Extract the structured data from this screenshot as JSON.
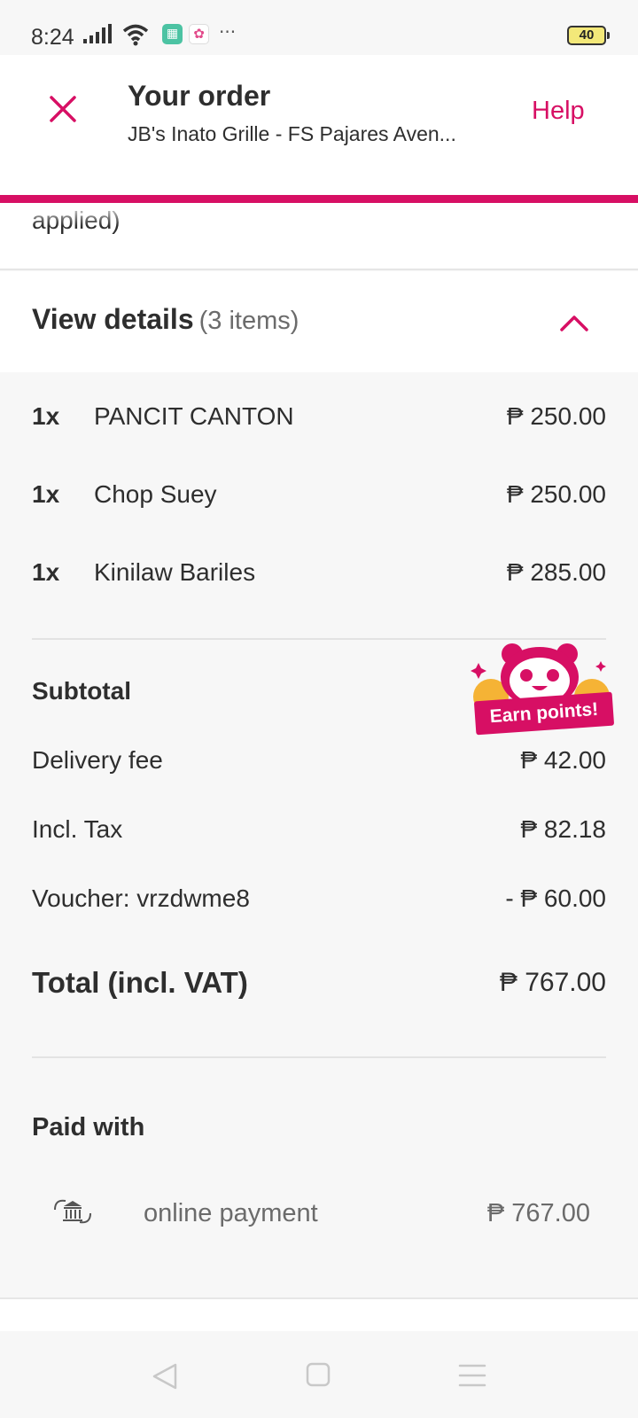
{
  "status_bar": {
    "time": "8:24",
    "battery": "40",
    "more": "···"
  },
  "header": {
    "title": "Your order",
    "subtitle": "JB's Inato Grille - FS Pajares Aven...",
    "help_label": "Help",
    "close_icon": "close-icon"
  },
  "applied_text": "applied)",
  "details": {
    "title": "View details",
    "count": "(3 items)",
    "toggle_icon": "chevron-up-icon"
  },
  "items": [
    {
      "qty": "1x",
      "name": "PANCIT CANTON",
      "price": "₱ 250.00"
    },
    {
      "qty": "1x",
      "name": "Chop Suey",
      "price": "₱ 250.00"
    },
    {
      "qty": "1x",
      "name": "Kinilaw Bariles",
      "price": "₱ 285.00"
    }
  ],
  "summary": {
    "subtotal_label": "Subtotal",
    "delivery_label": "Delivery fee",
    "delivery_value": "₱ 42.00",
    "tax_label": "Incl. Tax",
    "tax_value": "₱ 82.18",
    "voucher_label": "Voucher: vrzdwme8",
    "voucher_value": "- ₱ 60.00",
    "total_label": "Total (incl. VAT)",
    "total_value": "₱ 767.00"
  },
  "earn_badge": {
    "label": "Earn points!",
    "icon": "panda-mascot-icon"
  },
  "payment": {
    "section_label": "Paid with",
    "method": "online payment",
    "amount": "₱ 767.00",
    "icon": "bank-icon"
  },
  "colors": {
    "brand": "#d70f64",
    "text": "#2e2e2e",
    "muted": "#6b6b6b",
    "panel": "#f7f7f7"
  }
}
